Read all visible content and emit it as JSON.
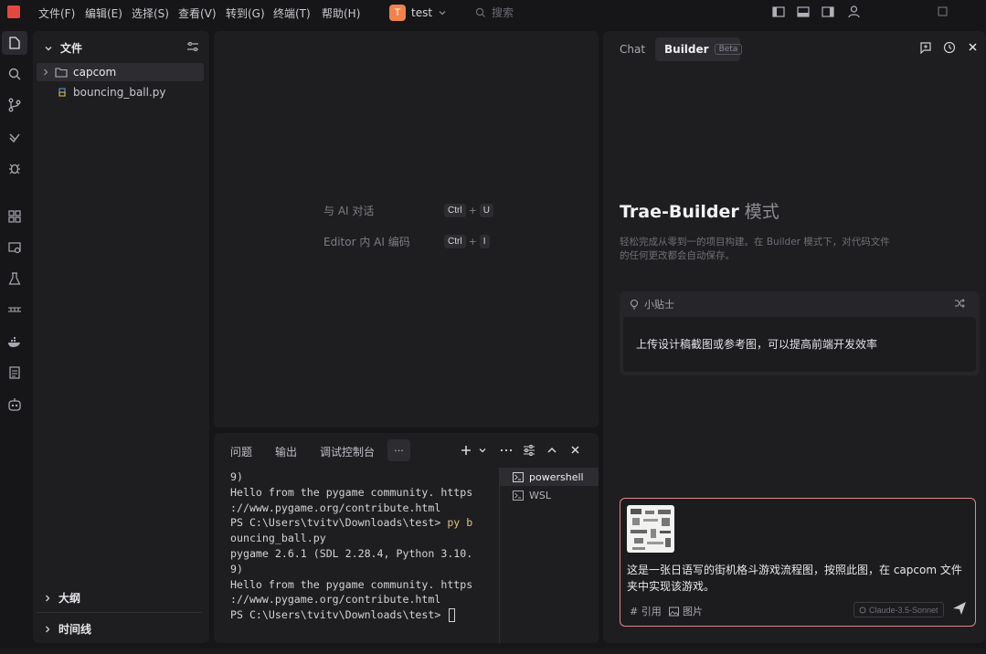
{
  "menu": [
    "文件(F)",
    "编辑(E)",
    "选择(S)",
    "查看(V)",
    "转到(G)",
    "终端(T)",
    "帮助(H)"
  ],
  "project": {
    "initial": "T",
    "name": "test"
  },
  "search": {
    "placeholder": "搜索"
  },
  "explorer": {
    "title": "文件",
    "folder": "capcom",
    "file": "bouncing_ball.py",
    "outline": "大纲",
    "timeline": "时间线"
  },
  "editor_hints": [
    {
      "label": "与 AI 对话",
      "keys": [
        "Ctrl",
        "U"
      ]
    },
    {
      "label": "Editor 内 AI 编码",
      "keys": [
        "Ctrl",
        "I"
      ]
    }
  ],
  "panel": {
    "tabs": [
      "问题",
      "输出",
      "调试控制台"
    ],
    "more": "···",
    "terminal_lines": [
      "9)",
      "Hello from the pygame community. https",
      "://www.pygame.org/contribute.html",
      "PS C:\\Users\\tvitv\\Downloads\\test> py b",
      "ouncing_ball.py",
      "pygame 2.6.1 (SDL 2.28.4, Python 3.10.",
      "9)",
      "Hello from the pygame community. https",
      "://www.pygame.org/contribute.html",
      "PS C:\\Users\\tvitv\\Downloads\\test> "
    ],
    "command_prefix": "PS C:\\Users\\tvitv\\Downloads\\test> ",
    "command_head": "py b",
    "terminals": [
      "powershell",
      "WSL"
    ]
  },
  "ai": {
    "tabs": {
      "chat": "Chat",
      "builder": "Builder",
      "beta": "Beta"
    },
    "heading_main": "Trae-Builder",
    "heading_sub": "模式",
    "description": "轻松完成从零到一的项目构建。在 Builder 模式下，对代码文件的任何更改都会自动保存。",
    "tip": {
      "title": "小贴士",
      "text": "上传设计稿截图或参考图，可以提高前端开发效率"
    },
    "input": {
      "text": "这是一张日语写的街机格斗游戏流程图，按照此图，在 capcom 文件夹中实现该游戏。",
      "reference": "# 引用",
      "image": "图片",
      "model": "Claude-3.5-Sonnet"
    }
  },
  "colors": {
    "background": "#161619",
    "panel": "#1e1e21",
    "accent_logo": "#e5483f",
    "avatar": "#f0834b",
    "input_border": "#e08686"
  }
}
